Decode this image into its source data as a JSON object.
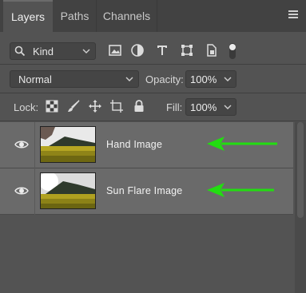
{
  "tabs": [
    {
      "label": "Layers",
      "active": true
    },
    {
      "label": "Paths",
      "active": false
    },
    {
      "label": "Channels",
      "active": false
    }
  ],
  "filter": {
    "kind_label": "Kind",
    "icons": [
      "image-filter-icon",
      "adjustment-filter-icon",
      "type-filter-icon",
      "shape-filter-icon",
      "smart-object-filter-icon",
      "filter-toggle-icon"
    ]
  },
  "blend": {
    "mode": "Normal",
    "opacity_label": "Opacity:",
    "opacity_value": "100%"
  },
  "lock": {
    "label": "Lock:",
    "icons": [
      "lock-transparent-pixels-icon",
      "lock-image-pixels-icon",
      "lock-position-icon",
      "lock-artboard-icon",
      "lock-all-icon"
    ],
    "fill_label": "Fill:",
    "fill_value": "100%"
  },
  "layers": [
    {
      "name": "Hand Image",
      "visible": true
    },
    {
      "name": "Sun Flare Image",
      "visible": true
    }
  ],
  "colors": {
    "panel_bg": "#535353",
    "tabbar_bg": "#424242",
    "layer_bg": "#6a6a6a",
    "arrow": "#22dd11"
  }
}
